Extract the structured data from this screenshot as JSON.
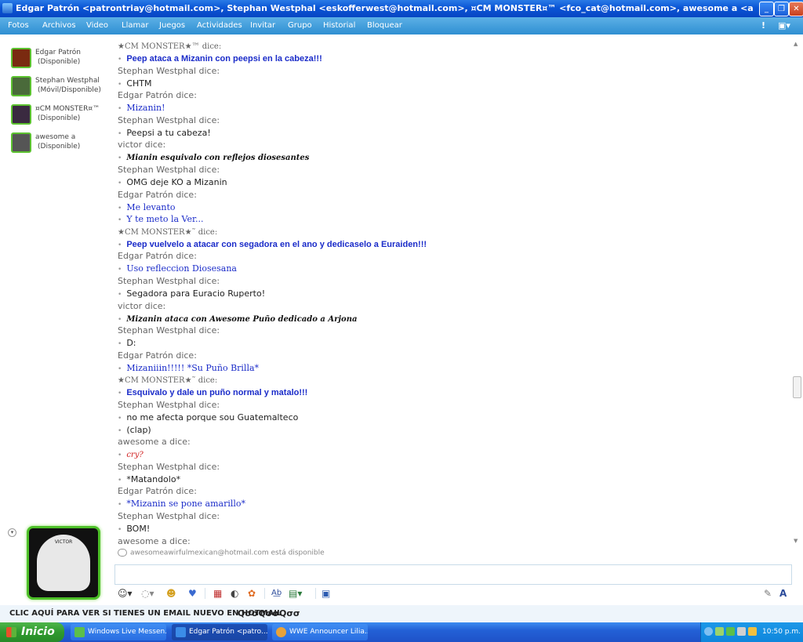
{
  "window": {
    "title": "Edgar Patrón <patrontriay@hotmail.com>, Stephan Westphal <eskofferwest@hotmail.com>, ¤CM MONSTER¤™ <fco_cat@hotmail.com>, awesome a <awesomeawirfulmexican@hotmail.com>",
    "min_label": "_",
    "max_label": "❐",
    "close_label": "✕"
  },
  "menu": {
    "items": [
      "Fotos",
      "Archivos",
      "Video",
      "Llamar",
      "Juegos",
      "Actividades",
      "Invitar",
      "Grupo",
      "Historial",
      "Bloquear"
    ],
    "disabled": [
      true,
      false,
      true,
      false,
      true,
      true,
      false,
      false,
      false,
      false
    ],
    "alert_icon": "!",
    "options_icon": "▣▾"
  },
  "contacts": [
    {
      "name": "Edgar Patrón",
      "status": "(Disponible)",
      "avatar_color": "#7a2a10"
    },
    {
      "name": "Stephan Westphal",
      "status": "(Móvil/Disponible)",
      "avatar_color": "#4a6a3a"
    },
    {
      "name": "¤CM MONSTER¤™",
      "status": "(Disponible)",
      "avatar_color": "#3a2a40"
    },
    {
      "name": "awesome a",
      "status": "(Disponible)",
      "avatar_color": "#555555"
    }
  ],
  "self_avatar_text": "VICTOR",
  "conversation": [
    {
      "kind": "sender",
      "text": "★CM MONSTER★™ dice:",
      "style": "monster"
    },
    {
      "kind": "msg",
      "text": "Peep ataca a Mizanin con peepsi en la cabeza!!!",
      "style": "m-bold"
    },
    {
      "kind": "sender",
      "text": "Stephan Westphal dice:",
      "style": ""
    },
    {
      "kind": "msg",
      "text": "CHTM",
      "style": "m-plain"
    },
    {
      "kind": "sender",
      "text": "Edgar Patrón dice:",
      "style": ""
    },
    {
      "kind": "msg",
      "text": "Mizanin!",
      "style": "m-hand"
    },
    {
      "kind": "sender",
      "text": "Stephan Westphal dice:",
      "style": ""
    },
    {
      "kind": "msg",
      "text": "Peepsi a tu cabeza!",
      "style": "m-plain"
    },
    {
      "kind": "sender",
      "text": "victor dice:",
      "style": ""
    },
    {
      "kind": "msg",
      "text": "Mianin esquivalo con reflejos diosesantes",
      "style": "m-ser"
    },
    {
      "kind": "sender",
      "text": "Stephan Westphal dice:",
      "style": ""
    },
    {
      "kind": "msg",
      "text": "OMG deje KO a Mizanin",
      "style": "m-plain"
    },
    {
      "kind": "sender",
      "text": "Edgar Patrón dice:",
      "style": ""
    },
    {
      "kind": "msg",
      "text": "Me levanto",
      "style": "m-hand"
    },
    {
      "kind": "msg",
      "text": "Y te meto la Ver...",
      "style": "m-hand"
    },
    {
      "kind": "sender",
      "text": "★CM MONSTER★˜ dice:",
      "style": "monster"
    },
    {
      "kind": "msg",
      "text": "Peep vuelvelo a atacar con segadora en el ano y dedicaselo a Euraiden!!!",
      "style": "m-bold"
    },
    {
      "kind": "sender",
      "text": "Edgar Patrón dice:",
      "style": ""
    },
    {
      "kind": "msg",
      "text": "Uso refleccion Diosesana",
      "style": "m-hand"
    },
    {
      "kind": "sender",
      "text": "Stephan Westphal dice:",
      "style": ""
    },
    {
      "kind": "msg",
      "text": "Segadora para Euracio Ruperto!",
      "style": "m-plain"
    },
    {
      "kind": "sender",
      "text": "victor dice:",
      "style": ""
    },
    {
      "kind": "msg",
      "text": "Mizanin ataca con Awesome Puño dedicado a Arjona",
      "style": "m-ser"
    },
    {
      "kind": "sender",
      "text": "Stephan Westphal dice:",
      "style": ""
    },
    {
      "kind": "msg",
      "text": "D:",
      "style": "m-plain"
    },
    {
      "kind": "sender",
      "text": "Edgar Patrón dice:",
      "style": ""
    },
    {
      "kind": "msg",
      "text": "Mizaniiin!!!!! *Su Puño Brilla*",
      "style": "m-hand"
    },
    {
      "kind": "sender",
      "text": "★CM MONSTER★˜ dice:",
      "style": "monster"
    },
    {
      "kind": "msg",
      "text": "Esquivalo y dale un puño normal y matalo!!!",
      "style": "m-bold"
    },
    {
      "kind": "sender",
      "text": "Stephan Westphal dice:",
      "style": ""
    },
    {
      "kind": "msg",
      "text": "no me afecta porque sou Guatemalteco",
      "style": "m-plain"
    },
    {
      "kind": "msg",
      "text": "(clap)",
      "style": "m-plain"
    },
    {
      "kind": "sender",
      "text": "awesome a dice:",
      "style": ""
    },
    {
      "kind": "msg",
      "text": "cry?",
      "style": "m-red"
    },
    {
      "kind": "sender",
      "text": "Stephan Westphal dice:",
      "style": ""
    },
    {
      "kind": "msg",
      "text": "*Matandolo*",
      "style": "m-plain"
    },
    {
      "kind": "sender",
      "text": "Edgar Patrón dice:",
      "style": ""
    },
    {
      "kind": "msg",
      "text": "*Mizanin se pone amarillo*",
      "style": "m-hand"
    },
    {
      "kind": "sender",
      "text": "Stephan Westphal dice:",
      "style": ""
    },
    {
      "kind": "msg",
      "text": "BOM!",
      "style": "m-plain"
    },
    {
      "kind": "sender",
      "text": "awesome a dice:",
      "style": ""
    }
  ],
  "status_line": "awesomeawirfulmexican@hotmail.com está disponible",
  "toolbar": {
    "emoticon": "☺▾",
    "wink": "◌▾",
    "nudge": "☻",
    "voice": "♥",
    "background": "▦",
    "games": "◐",
    "activities": "✿",
    "font": "A͟b",
    "image": "▤▾",
    "send_files": "▣",
    "pen": "✎",
    "text_format": "A"
  },
  "ad_text": "CLIC AQUÍ PARA VER SI TIENES UN EMAIL NUEVO EN HOTMAIL",
  "ad_icons": "QσσQσσQσσ",
  "taskbar": {
    "start_label": "Inicio",
    "tasks": [
      {
        "label": "Windows Live Messen...",
        "icon_color": "#5cbf4a"
      },
      {
        "label": "Edgar Patrón <patro...",
        "icon_color": "#3b8ce8"
      },
      {
        "label": "WWE Announcer Lilia...",
        "icon_color": "#e8a23a"
      }
    ],
    "clock": "10:50 p.m."
  }
}
